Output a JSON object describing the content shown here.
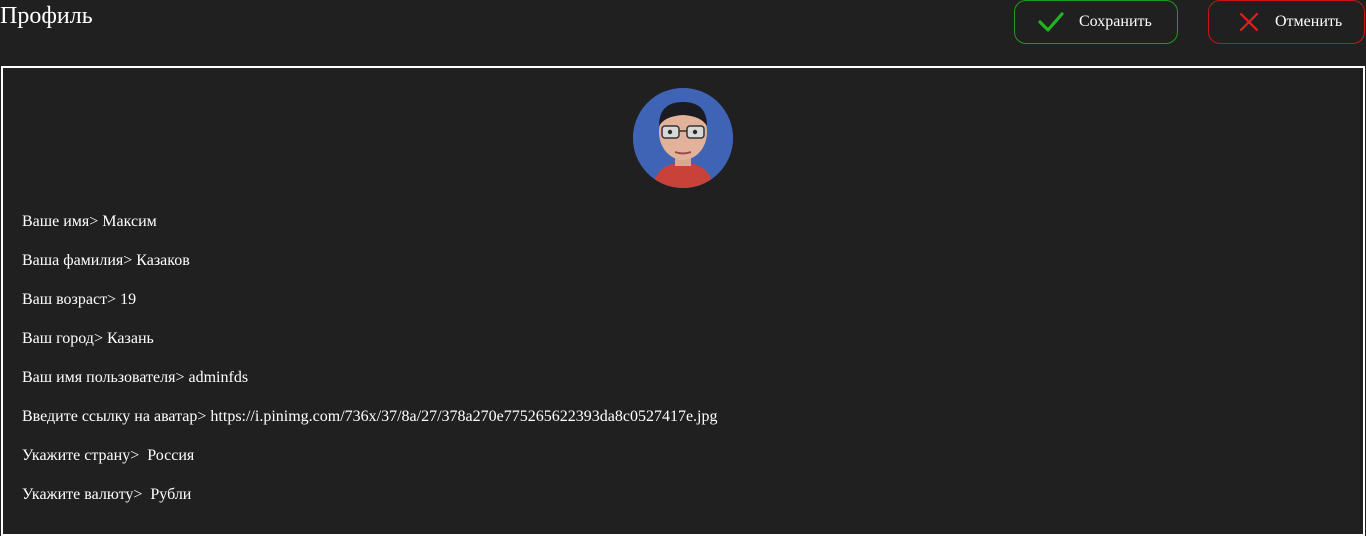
{
  "header": {
    "title": "Профиль",
    "save_label": "Сохранить",
    "cancel_label": "Отменить"
  },
  "profile": {
    "avatar_icon": "user-avatar",
    "fields": [
      {
        "label": "Ваше имя>",
        "value": "Максим"
      },
      {
        "label": "Ваша фамилия>",
        "value": "Казаков"
      },
      {
        "label": "Ваш возраст>",
        "value": "19"
      },
      {
        "label": "Ваш город>",
        "value": "Казань"
      },
      {
        "label": "Ваш имя пользователя>",
        "value": "adminfds"
      },
      {
        "label": "Введите ссылку на аватар>",
        "value": "https://i.pinimg.com/736x/37/8a/27/378a270e775265622393da8c0527417e.jpg"
      },
      {
        "label": "Укажите страну>",
        "value": "Россия"
      },
      {
        "label": "Укажите валюту>",
        "value": "Рубли"
      }
    ]
  },
  "colors": {
    "background": "#202020",
    "save_border": "#1f9c1f",
    "cancel_border": "#c81414",
    "check_icon": "#22b322",
    "close_icon": "#e01e1e"
  }
}
